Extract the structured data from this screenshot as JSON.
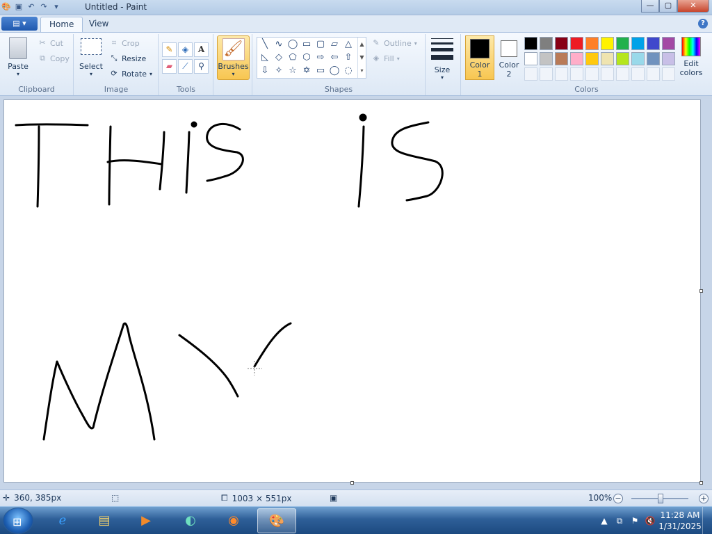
{
  "window": {
    "title": "Untitled - Paint",
    "minimize": "—",
    "maximize": "▢",
    "close": "✕"
  },
  "quick_access": [
    "paint-app-icon",
    "save-icon",
    "undo-icon",
    "redo-icon",
    "customize-icon"
  ],
  "ribbon": {
    "app_menu_label": "▤ ▾",
    "tabs": [
      {
        "label": "Home",
        "active": true
      },
      {
        "label": "View",
        "active": false
      }
    ],
    "help_icon": "?",
    "clipboard": {
      "label": "Clipboard",
      "paste": "Paste",
      "cut": "Cut",
      "copy": "Copy"
    },
    "image": {
      "label": "Image",
      "select": "Select",
      "crop": "Crop",
      "resize": "Resize",
      "rotate": "Rotate"
    },
    "tools": {
      "label": "Tools",
      "items": [
        "pencil-icon",
        "fill-icon",
        "text-icon",
        "eraser-icon",
        "color-picker-icon",
        "magnifier-icon"
      ]
    },
    "brushes": {
      "label": "Brushes"
    },
    "shapes": {
      "label": "Shapes",
      "outline": "Outline",
      "fill": "Fill",
      "glyphs": [
        "╲",
        "∿",
        "◯",
        "▭",
        "▢",
        "▱",
        "△",
        "◺",
        "◇",
        "⬠",
        "⬡",
        "⇨",
        "⇦",
        "⇧",
        "⇩",
        "✧",
        "☆",
        "✡",
        "▭",
        "◯",
        "◌"
      ]
    },
    "size": {
      "label": "Size"
    },
    "colors": {
      "label": "Colors",
      "color1_label_a": "Color",
      "color1_label_b": "1",
      "color2_label_a": "Color",
      "color2_label_b": "2",
      "color1": "#000000",
      "color2": "#ffffff",
      "edit_a": "Edit",
      "edit_b": "colors",
      "palette_row1": [
        "#000000",
        "#7f7f7f",
        "#880015",
        "#ed1c24",
        "#ff7f27",
        "#fff200",
        "#22b14c",
        "#00a2e8",
        "#3f48cc",
        "#a349a4"
      ],
      "palette_row2": [
        "#ffffff",
        "#c3c3c3",
        "#b97a57",
        "#ffaec9",
        "#ffc90e",
        "#efe4b0",
        "#b5e61d",
        "#99d9ea",
        "#7092be",
        "#c8bfe7"
      ]
    }
  },
  "canvas": {
    "background": "#ffffff",
    "stroke_color": "#000000"
  },
  "status": {
    "cursor_pos": "360, 385px",
    "canvas_size": "1003 × 551px",
    "zoom": "100%"
  },
  "taskbar": {
    "apps": [
      "internet-explorer-icon",
      "file-explorer-icon",
      "media-player-icon",
      "app-icon",
      "firefox-icon",
      "paint-icon"
    ],
    "clock_time": "11:28 AM",
    "clock_date": "1/31/2025"
  }
}
